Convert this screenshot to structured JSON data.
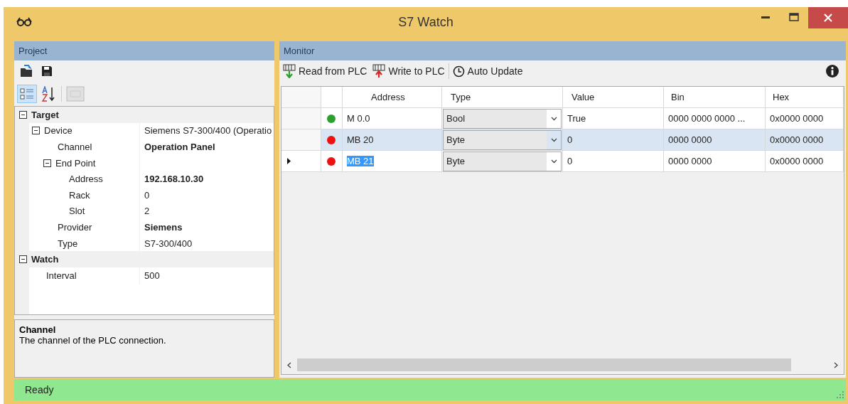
{
  "window": {
    "title": "S7 Watch"
  },
  "project": {
    "title": "Project",
    "properties": [
      {
        "label": "Target",
        "kind": "category",
        "expanded": true,
        "children": [
          {
            "label": "Device",
            "value": "Siemens S7-300/400 (Operatio",
            "expanded": true,
            "children": [
              {
                "label": "Channel",
                "value": "Operation Panel",
                "bold": true
              },
              {
                "label": "End Point",
                "expanded": true,
                "children": [
                  {
                    "label": "Address",
                    "value": "192.168.10.30",
                    "bold": true
                  },
                  {
                    "label": "Rack",
                    "value": "0"
                  },
                  {
                    "label": "Slot",
                    "value": "2"
                  }
                ]
              },
              {
                "label": "Provider",
                "value": "Siemens",
                "bold": true
              },
              {
                "label": "Type",
                "value": "S7-300/400"
              }
            ]
          }
        ]
      },
      {
        "label": "Watch",
        "kind": "category",
        "expanded": true,
        "children": [
          {
            "label": "Interval",
            "value": "500"
          }
        ]
      }
    ],
    "help": {
      "title": "Channel",
      "text": "The channel of the PLC connection."
    }
  },
  "monitor": {
    "title": "Monitor",
    "toolbar": [
      {
        "kind": "read",
        "label": "Read from PLC"
      },
      {
        "kind": "write",
        "label": "Write to PLC"
      },
      {
        "kind": "clock",
        "label": "Auto Update"
      }
    ],
    "columns": [
      "Address",
      "Type",
      "Value",
      "Bin",
      "Hex"
    ],
    "rows": [
      {
        "color": "#2ca02c",
        "address": "M 0.0",
        "type": "Bool",
        "value": "True",
        "bin": "0000 0000 0000 ...",
        "hex": "0x0000 0000",
        "selected": false,
        "current": false
      },
      {
        "color": "#ee1111",
        "address": "MB 20",
        "type": "Byte",
        "value": "0",
        "bin": "0000 0000",
        "hex": "0x0000 0000",
        "selected": true,
        "current": false
      },
      {
        "color": "#ee1111",
        "address": "MB 21",
        "type": "Byte",
        "value": "0",
        "bin": "0000 0000",
        "hex": "0x0000 0000",
        "selected": false,
        "current": true,
        "editing": true
      }
    ]
  },
  "status_bar": {
    "text": "Ready"
  }
}
